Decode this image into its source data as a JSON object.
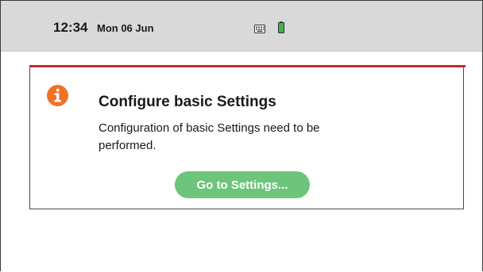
{
  "status_bar": {
    "time": "12:34",
    "date": "Mon 06 Jun",
    "icons": [
      "keyboard-icon",
      "battery-icon"
    ]
  },
  "dialog": {
    "icon": "info-icon",
    "title": "Configure basic Settings",
    "message": "Configuration of basic Settings need to be performed.",
    "button_label": "Go to Settings..."
  },
  "colors": {
    "status_bar_bg": "#d9d9d9",
    "dialog_accent": "#c9272f",
    "info_icon": "#f07226",
    "button_bg": "#6cc57a",
    "battery": "#3db54a"
  }
}
